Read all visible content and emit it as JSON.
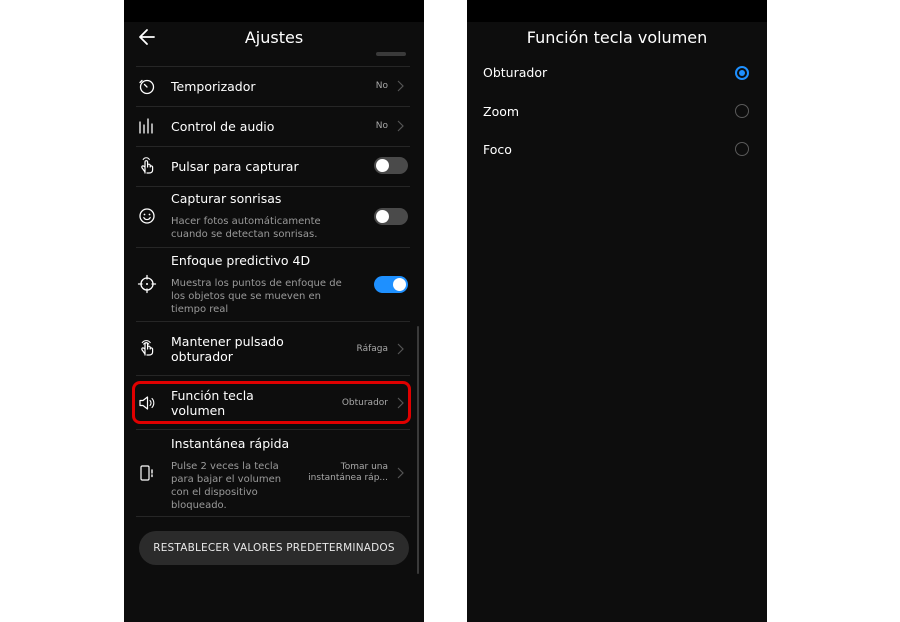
{
  "left": {
    "title": "Ajustes",
    "rows": [
      {
        "label": "Temporizador",
        "value": "No"
      },
      {
        "label": "Control de audio",
        "value": "No"
      },
      {
        "label": "Pulsar para capturar",
        "toggle": false
      },
      {
        "label": "Capturar sonrisas",
        "desc": "Hacer fotos automáticamente cuando se detectan sonrisas.",
        "toggle": false
      },
      {
        "label": "Enfoque predictivo 4D",
        "desc": "Muestra los puntos de enfoque de los objetos que se mueven en tiempo real",
        "toggle": true
      },
      {
        "label": "Mantener pulsado obturador",
        "value": "Ráfaga"
      },
      {
        "label": "Función tecla volumen",
        "value": "Obturador"
      },
      {
        "label": "Instantánea rápida",
        "desc": "Pulse 2 veces la tecla para bajar el volumen con el dispositivo bloqueado.",
        "value": "Tomar una instantánea ráp..."
      }
    ],
    "reset_label": "RESTABLECER VALORES PREDETERMINADOS"
  },
  "right": {
    "title": "Función tecla volumen",
    "options": [
      {
        "label": "Obturador",
        "selected": true
      },
      {
        "label": "Zoom",
        "selected": false
      },
      {
        "label": "Foco",
        "selected": false
      }
    ]
  },
  "colors": {
    "accent": "#1e90ff",
    "highlight": "#e00000",
    "background": "#0d0d0d"
  },
  "icons": [
    "back-arrow-icon",
    "timer-icon",
    "audio-bars-icon",
    "touch-icon",
    "smile-icon",
    "focus-target-icon",
    "hold-finger-icon",
    "speaker-icon",
    "snapshot-phone-icon",
    "chevron-right-icon"
  ]
}
